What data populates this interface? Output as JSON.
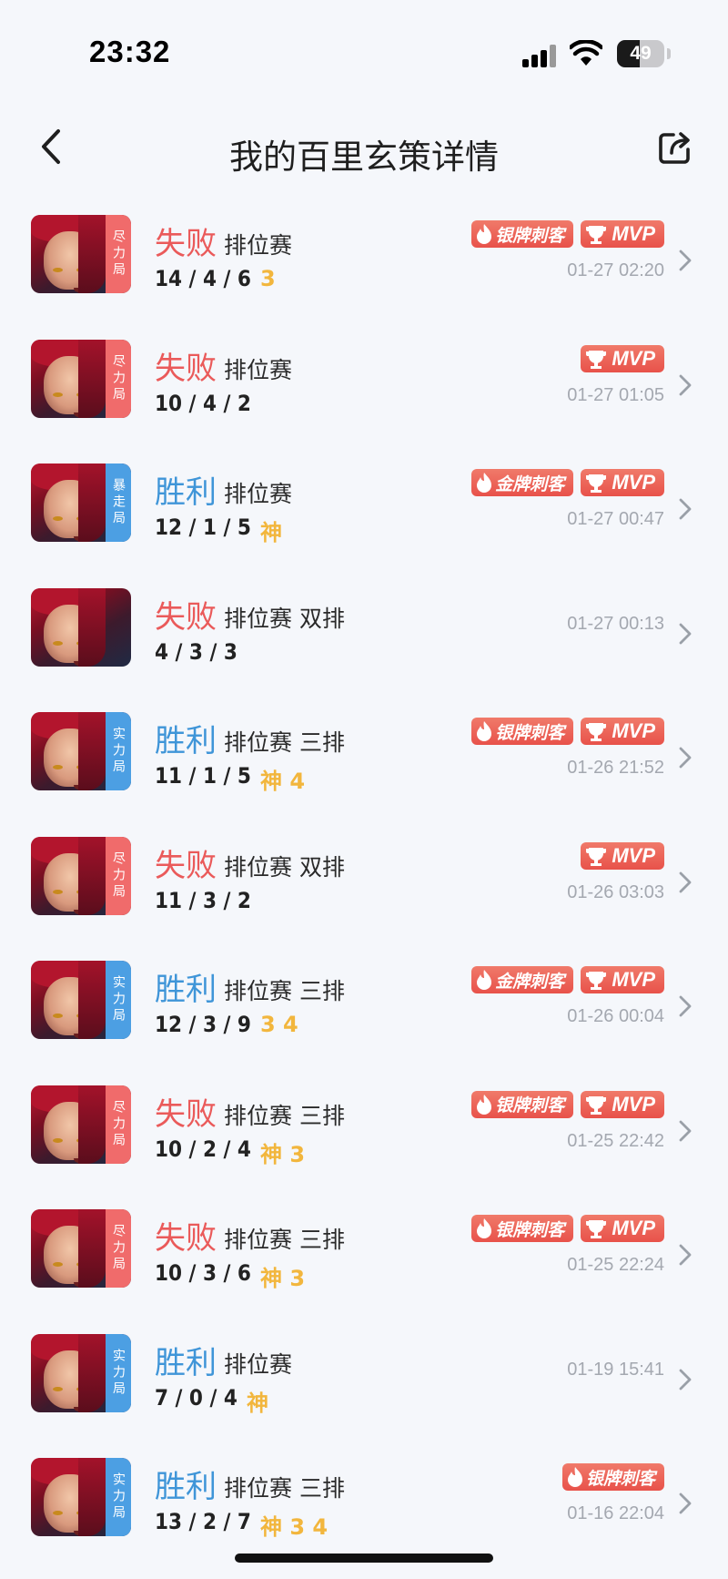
{
  "status_bar": {
    "time": "23:32",
    "battery": "49",
    "battery_level": 0.49
  },
  "nav": {
    "title": "我的百里玄策详情",
    "back_icon": "chevron-left-icon",
    "share_icon": "share-icon"
  },
  "colors": {
    "lose": "#ea5a5a",
    "win": "#3f95d8",
    "tag_red": "#f06b6b",
    "tag_blue": "#4c9fe3",
    "gold": "#f2b63d",
    "badge": "#e8524a"
  },
  "matches": [
    {
      "result": "失败",
      "result_type": "lose",
      "mode": "排位赛",
      "tag": "尽力局",
      "tag_color": "red",
      "kda": "14 / 4 / 6",
      "kda_badges": "3",
      "badges": [
        "银牌刺客",
        "MVP"
      ],
      "time": "01-27 02:20"
    },
    {
      "result": "失败",
      "result_type": "lose",
      "mode": "排位赛",
      "tag": "尽力局",
      "tag_color": "red",
      "kda": "10 / 4 / 2",
      "kda_badges": "",
      "badges": [
        "MVP"
      ],
      "time": "01-27 01:05"
    },
    {
      "result": "胜利",
      "result_type": "win",
      "mode": "排位赛",
      "tag": "暴走局",
      "tag_color": "blue",
      "kda": "12 / 1 / 5",
      "kda_badges": "神",
      "badges": [
        "金牌刺客",
        "MVP"
      ],
      "time": "01-27 00:47"
    },
    {
      "result": "失败",
      "result_type": "lose",
      "mode": "排位赛 双排",
      "tag": "",
      "tag_color": "",
      "kda": "4 / 3 / 3",
      "kda_badges": "",
      "badges": [],
      "time": "01-27 00:13"
    },
    {
      "result": "胜利",
      "result_type": "win",
      "mode": "排位赛 三排",
      "tag": "实力局",
      "tag_color": "blue",
      "kda": "11 / 1 / 5",
      "kda_badges": "神 4",
      "badges": [
        "银牌刺客",
        "MVP"
      ],
      "time": "01-26 21:52"
    },
    {
      "result": "失败",
      "result_type": "lose",
      "mode": "排位赛 双排",
      "tag": "尽力局",
      "tag_color": "red",
      "kda": "11 / 3 / 2",
      "kda_badges": "",
      "badges": [
        "MVP"
      ],
      "time": "01-26 03:03"
    },
    {
      "result": "胜利",
      "result_type": "win",
      "mode": "排位赛 三排",
      "tag": "实力局",
      "tag_color": "blue",
      "kda": "12 / 3 / 9",
      "kda_badges": "3 4",
      "badges": [
        "金牌刺客",
        "MVP"
      ],
      "time": "01-26 00:04"
    },
    {
      "result": "失败",
      "result_type": "lose",
      "mode": "排位赛 三排",
      "tag": "尽力局",
      "tag_color": "red",
      "kda": "10 / 2 / 4",
      "kda_badges": "神 3",
      "badges": [
        "银牌刺客",
        "MVP"
      ],
      "time": "01-25 22:42"
    },
    {
      "result": "失败",
      "result_type": "lose",
      "mode": "排位赛 三排",
      "tag": "尽力局",
      "tag_color": "red",
      "kda": "10 / 3 / 6",
      "kda_badges": "神 3",
      "badges": [
        "银牌刺客",
        "MVP"
      ],
      "time": "01-25 22:24"
    },
    {
      "result": "胜利",
      "result_type": "win",
      "mode": "排位赛",
      "tag": "实力局",
      "tag_color": "blue",
      "kda": "7 / 0 / 4",
      "kda_badges": "神",
      "badges": [],
      "time": "01-19 15:41"
    },
    {
      "result": "胜利",
      "result_type": "win",
      "mode": "排位赛 三排",
      "tag": "实力局",
      "tag_color": "blue",
      "kda": "13 / 2 / 7",
      "kda_badges": "神 3 4",
      "badges": [
        "银牌刺客"
      ],
      "time": "01-16 22:04"
    }
  ]
}
